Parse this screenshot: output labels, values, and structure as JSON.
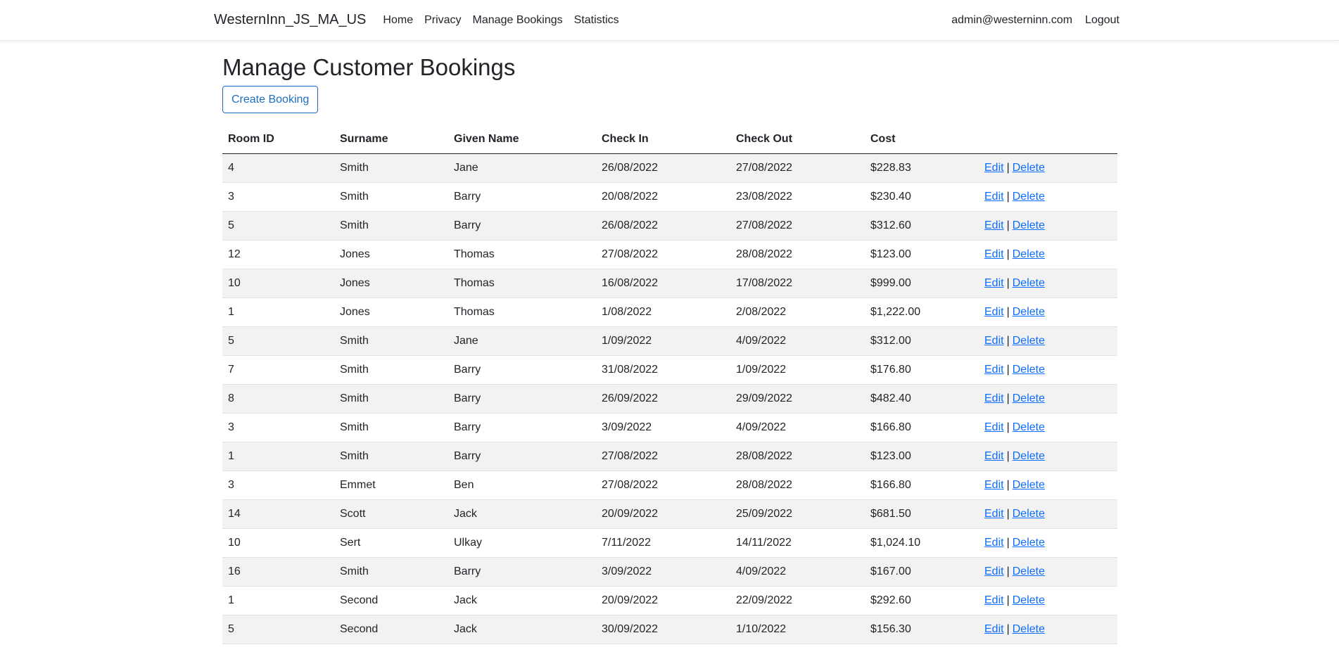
{
  "navbar": {
    "brand": "WesternInn_JS_MA_US",
    "links": [
      "Home",
      "Privacy",
      "Manage Bookings",
      "Statistics"
    ],
    "user_email": "admin@westerninn.com",
    "logout_label": "Logout"
  },
  "page": {
    "title": "Manage Customer Bookings",
    "create_button_label": "Create Booking"
  },
  "table": {
    "headers": [
      "Room ID",
      "Surname",
      "Given Name",
      "Check In",
      "Check Out",
      "Cost",
      ""
    ],
    "edit_label": "Edit",
    "separator": "|",
    "delete_label": "Delete",
    "rows": [
      [
        "4",
        "Smith",
        "Jane",
        "26/08/2022",
        "27/08/2022",
        "$228.83"
      ],
      [
        "3",
        "Smith",
        "Barry",
        "20/08/2022",
        "23/08/2022",
        "$230.40"
      ],
      [
        "5",
        "Smith",
        "Barry",
        "26/08/2022",
        "27/08/2022",
        "$312.60"
      ],
      [
        "12",
        "Jones",
        "Thomas",
        "27/08/2022",
        "28/08/2022",
        "$123.00"
      ],
      [
        "10",
        "Jones",
        "Thomas",
        "16/08/2022",
        "17/08/2022",
        "$999.00"
      ],
      [
        "1",
        "Jones",
        "Thomas",
        "1/08/2022",
        "2/08/2022",
        "$1,222.00"
      ],
      [
        "5",
        "Smith",
        "Jane",
        "1/09/2022",
        "4/09/2022",
        "$312.00"
      ],
      [
        "7",
        "Smith",
        "Barry",
        "31/08/2022",
        "1/09/2022",
        "$176.80"
      ],
      [
        "8",
        "Smith",
        "Barry",
        "26/09/2022",
        "29/09/2022",
        "$482.40"
      ],
      [
        "3",
        "Smith",
        "Barry",
        "3/09/2022",
        "4/09/2022",
        "$166.80"
      ],
      [
        "1",
        "Smith",
        "Barry",
        "27/08/2022",
        "28/08/2022",
        "$123.00"
      ],
      [
        "3",
        "Emmet",
        "Ben",
        "27/08/2022",
        "28/08/2022",
        "$166.80"
      ],
      [
        "14",
        "Scott",
        "Jack",
        "20/09/2022",
        "25/09/2022",
        "$681.50"
      ],
      [
        "10",
        "Sert",
        "Ulkay",
        "7/11/2022",
        "14/11/2022",
        "$1,024.10"
      ],
      [
        "16",
        "Smith",
        "Barry",
        "3/09/2022",
        "4/09/2022",
        "$167.00"
      ],
      [
        "1",
        "Second",
        "Jack",
        "20/09/2022",
        "22/09/2022",
        "$292.60"
      ],
      [
        "5",
        "Second",
        "Jack",
        "30/09/2022",
        "1/10/2022",
        "$156.30"
      ]
    ]
  }
}
